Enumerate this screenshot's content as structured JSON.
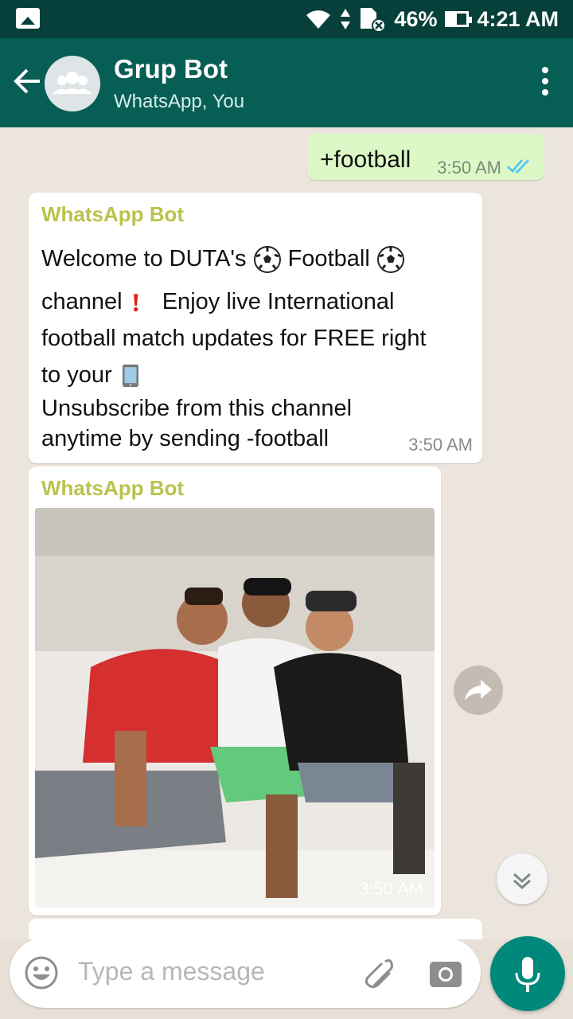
{
  "status_bar": {
    "battery": "46%",
    "time": "4:21 AM"
  },
  "header": {
    "title": "Grup Bot",
    "subtitle": "WhatsApp, You"
  },
  "chat": {
    "outgoing": [
      {
        "text": "+football",
        "time": "3:50 AM"
      }
    ],
    "incoming": [
      {
        "sender": "WhatsApp Bot",
        "line1_a": "Welcome to DUTA's",
        "line1_b": "Football",
        "line2_a": "channel",
        "line2_b": "Enjoy live International",
        "line3": "football match updates for FREE right",
        "line4": "to your",
        "line5": "Unsubscribe from this channel",
        "line6": "anytime by sending -football",
        "time": "3:50 AM"
      },
      {
        "sender": "WhatsApp Bot",
        "time": "3:50 AM"
      }
    ]
  },
  "composer": {
    "placeholder": "Type a message"
  },
  "colors": {
    "header": "#075e54",
    "statusbar": "#07403a",
    "outgoing": "#dcf8c6",
    "mic": "#00897b",
    "sender": "#b8c34b"
  }
}
